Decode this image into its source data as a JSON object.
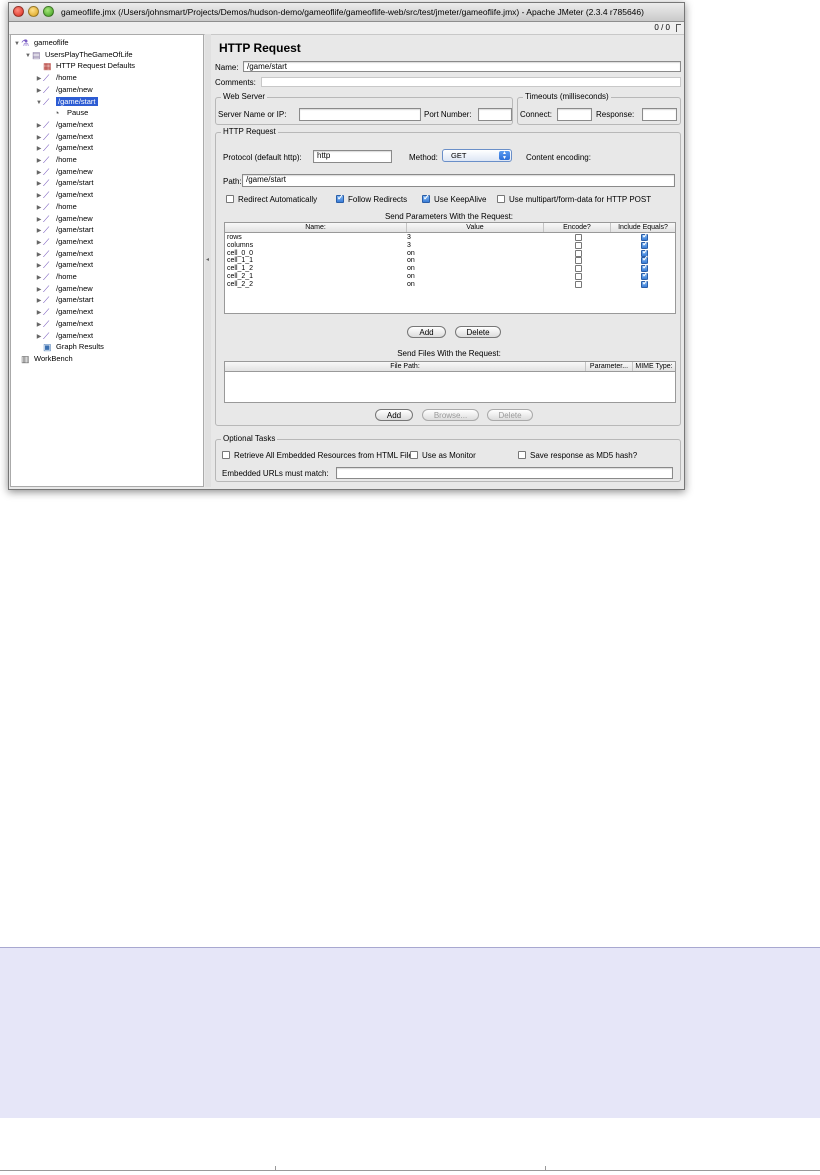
{
  "window": {
    "title": "gameoflife.jmx (/Users/johnsmart/Projects/Demos/hudson-demo/gameoflife/gameoflife-web/src/test/jmeter/gameoflife.jmx) - Apache JMeter (2.3.4 r785646)",
    "counter": "0 / 0"
  },
  "tree": {
    "items": [
      {
        "label": "gameoflife",
        "icon": "flask-icon",
        "twisty": "▼"
      },
      {
        "label": "UsersPlayTheGameOfLife",
        "icon": "thread-group-icon",
        "twisty": "▼"
      },
      {
        "label": "HTTP Request Defaults",
        "icon": "config-icon",
        "twisty": ""
      },
      {
        "label": "/home",
        "icon": "sampler-icon",
        "twisty": "▶"
      },
      {
        "label": "/game/new",
        "icon": "sampler-icon",
        "twisty": "▶"
      },
      {
        "label": "/game/start",
        "icon": "sampler-icon",
        "twisty": "▼",
        "selected": true
      },
      {
        "label": "Pause",
        "icon": "timer-icon",
        "twisty": ""
      },
      {
        "label": "/game/next",
        "icon": "sampler-icon",
        "twisty": "▶"
      },
      {
        "label": "/game/next",
        "icon": "sampler-icon",
        "twisty": "▶"
      },
      {
        "label": "/game/next",
        "icon": "sampler-icon",
        "twisty": "▶"
      },
      {
        "label": "/home",
        "icon": "sampler-icon",
        "twisty": "▶"
      },
      {
        "label": "/game/new",
        "icon": "sampler-icon",
        "twisty": "▶"
      },
      {
        "label": "/game/start",
        "icon": "sampler-icon",
        "twisty": "▶"
      },
      {
        "label": "/game/next",
        "icon": "sampler-icon",
        "twisty": "▶"
      },
      {
        "label": "/home",
        "icon": "sampler-icon",
        "twisty": "▶"
      },
      {
        "label": "/game/new",
        "icon": "sampler-icon",
        "twisty": "▶"
      },
      {
        "label": "/game/start",
        "icon": "sampler-icon",
        "twisty": "▶"
      },
      {
        "label": "/game/next",
        "icon": "sampler-icon",
        "twisty": "▶"
      },
      {
        "label": "/game/next",
        "icon": "sampler-icon",
        "twisty": "▶"
      },
      {
        "label": "/game/next",
        "icon": "sampler-icon",
        "twisty": "▶"
      },
      {
        "label": "/home",
        "icon": "sampler-icon",
        "twisty": "▶"
      },
      {
        "label": "/game/new",
        "icon": "sampler-icon",
        "twisty": "▶"
      },
      {
        "label": "/game/start",
        "icon": "sampler-icon",
        "twisty": "▶"
      },
      {
        "label": "/game/next",
        "icon": "sampler-icon",
        "twisty": "▶"
      },
      {
        "label": "/game/next",
        "icon": "sampler-icon",
        "twisty": "▶"
      },
      {
        "label": "/game/next",
        "icon": "sampler-icon",
        "twisty": "▶"
      },
      {
        "label": "Graph Results",
        "icon": "graph-icon",
        "twisty": ""
      },
      {
        "label": "WorkBench",
        "icon": "workbench-icon",
        "twisty": ""
      }
    ]
  },
  "panel": {
    "title": "HTTP Request",
    "name_label": "Name:",
    "name_value": "/game/start",
    "comments_label": "Comments:",
    "web_server": {
      "title": "Web Server",
      "server_label": "Server Name or IP:",
      "server_value": "",
      "port_label": "Port Number:",
      "port_value": ""
    },
    "timeouts": {
      "title": "Timeouts (milliseconds)",
      "connect_label": "Connect:",
      "connect_value": "",
      "response_label": "Response:",
      "response_value": ""
    },
    "http_request": {
      "title": "HTTP Request",
      "protocol_label": "Protocol (default http):",
      "protocol_value": "http",
      "method_label": "Method:",
      "method_value": "GET",
      "encoding_label": "Content encoding:",
      "path_label": "Path:",
      "path_value": "/game/start",
      "redirect_auto": {
        "label": "Redirect Automatically",
        "checked": false
      },
      "follow_redirects": {
        "label": "Follow Redirects",
        "checked": true
      },
      "keepalive": {
        "label": "Use KeepAlive",
        "checked": true
      },
      "multipart": {
        "label": "Use multipart/form-data for HTTP POST",
        "checked": false
      }
    },
    "params": {
      "title": "Send Parameters With the Request:",
      "columns": [
        "Name:",
        "Value",
        "Encode?",
        "Include Equals?"
      ],
      "rows": [
        {
          "name": "rows",
          "value": "3",
          "encode": false,
          "include_equals": true
        },
        {
          "name": "columns",
          "value": "3",
          "encode": false,
          "include_equals": true
        },
        {
          "name": "cell_0_0",
          "value": "on",
          "encode": false,
          "include_equals": true
        },
        {
          "name": "cell_1_1",
          "value": "on",
          "encode": false,
          "include_equals": true
        },
        {
          "name": "cell_1_2",
          "value": "on",
          "encode": false,
          "include_equals": true
        },
        {
          "name": "cell_2_1",
          "value": "on",
          "encode": false,
          "include_equals": true
        },
        {
          "name": "cell_2_2",
          "value": "on",
          "encode": false,
          "include_equals": true
        }
      ],
      "add_label": "Add",
      "delete_label": "Delete"
    },
    "files": {
      "title": "Send Files With the Request:",
      "columns": [
        "File Path:",
        "Parameter...",
        "MIME Type:"
      ],
      "add_label": "Add",
      "browse_label": "Browse...",
      "delete_label": "Delete"
    },
    "optional": {
      "title": "Optional Tasks",
      "retrieve": {
        "label": "Retrieve All Embedded Resources from HTML Files",
        "checked": false
      },
      "monitor": {
        "label": "Use as Monitor",
        "checked": false
      },
      "md5": {
        "label": "Save response as MD5 hash?",
        "checked": false
      },
      "embedded_label": "Embedded URLs must match:",
      "embedded_value": ""
    }
  }
}
